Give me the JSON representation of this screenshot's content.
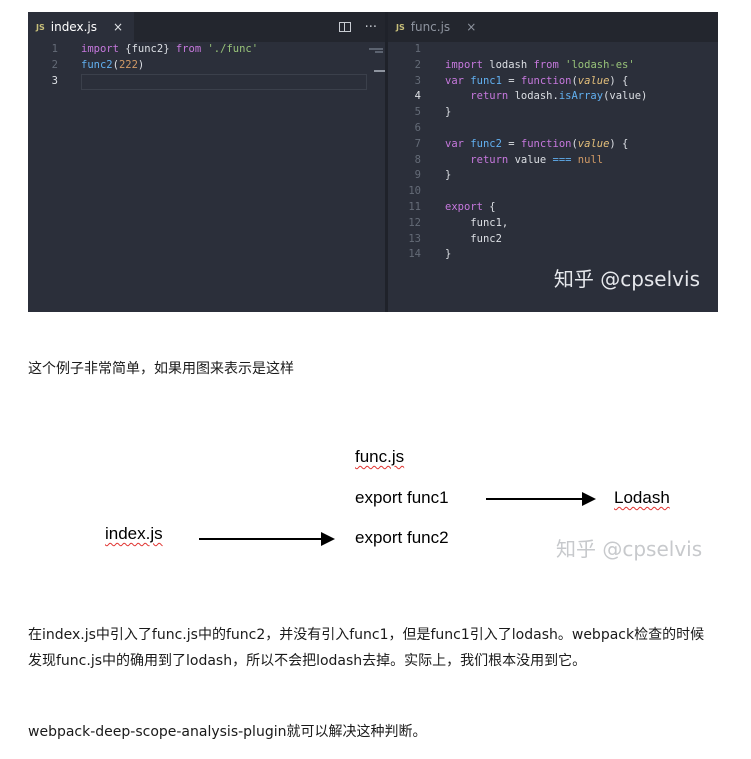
{
  "editor": {
    "left_tab": {
      "badge": "JS",
      "label": "index.js",
      "close": "×"
    },
    "right_tab": {
      "badge": "JS",
      "label": "func.js",
      "close": "×"
    },
    "actions": {
      "more": "···"
    },
    "watermark": "知乎 @cpselvis",
    "left_lines": [
      {
        "n": "1",
        "html": "<span class='kw'>import</span> <span class='pl'>{func2}</span> <span class='kw'>from</span> <span class='str'>'./func'</span>"
      },
      {
        "n": "2",
        "html": "<span class='fn'>func2</span><span class='pl'>(</span><span class='num'>222</span><span class='pl'>)</span>"
      },
      {
        "n": "3",
        "html": ""
      }
    ],
    "right_lines": [
      {
        "n": "1",
        "html": ""
      },
      {
        "n": "2",
        "html": "<span class='kw'>import</span> <span class='pl'>lodash</span> <span class='kw'>from</span> <span class='str'>'lodash-es'</span>"
      },
      {
        "n": "3",
        "html": "<span class='kw'>var</span> <span class='fn'>func1</span> <span class='pl'>=</span> <span class='kw'>function</span><span class='pl'>(</span><span class='itl'>value</span><span class='pl'>) {</span>"
      },
      {
        "n": "4",
        "html": "    <span class='kw'>return</span> <span class='pl'>lodash.</span><span class='fn'>isArray</span><span class='pl'>(value)</span>"
      },
      {
        "n": "5",
        "html": "<span class='pl'>}</span>"
      },
      {
        "n": "6",
        "html": ""
      },
      {
        "n": "7",
        "html": "<span class='kw'>var</span> <span class='fn'>func2</span> <span class='pl'>=</span> <span class='kw'>function</span><span class='pl'>(</span><span class='itl'>value</span><span class='pl'>) {</span>"
      },
      {
        "n": "8",
        "html": "    <span class='kw'>return</span> <span class='pl'>value</span> <span class='fn'>===</span> <span class='num'>null</span>"
      },
      {
        "n": "9",
        "html": "<span class='pl'>}</span>"
      },
      {
        "n": "10",
        "html": ""
      },
      {
        "n": "11",
        "html": "<span class='kw'>export</span> <span class='pl'>{</span>"
      },
      {
        "n": "12",
        "html": "    <span class='pl'>func1,</span>"
      },
      {
        "n": "13",
        "html": "    <span class='pl'>func2</span>"
      },
      {
        "n": "14",
        "html": "<span class='pl'>}</span>"
      }
    ]
  },
  "intro_text": "这个例子非常简单，如果用图来表示是这样",
  "diagram": {
    "func_js": "func.js",
    "export_func1": "export func1",
    "lodash": "Lodash",
    "index_js": "index.js",
    "export_func2": "export func2",
    "watermark": "知乎 @cpselvis"
  },
  "explanation_text": "在index.js中引入了func.js中的func2，并没有引入func1，但是func1引入了lodash。webpack检查的时候发现func.js中的确用到了lodash，所以不会把lodash去掉。实际上，我们根本没用到它。",
  "plugin_text": "webpack-deep-scope-analysis-plugin就可以解决这种判断。"
}
